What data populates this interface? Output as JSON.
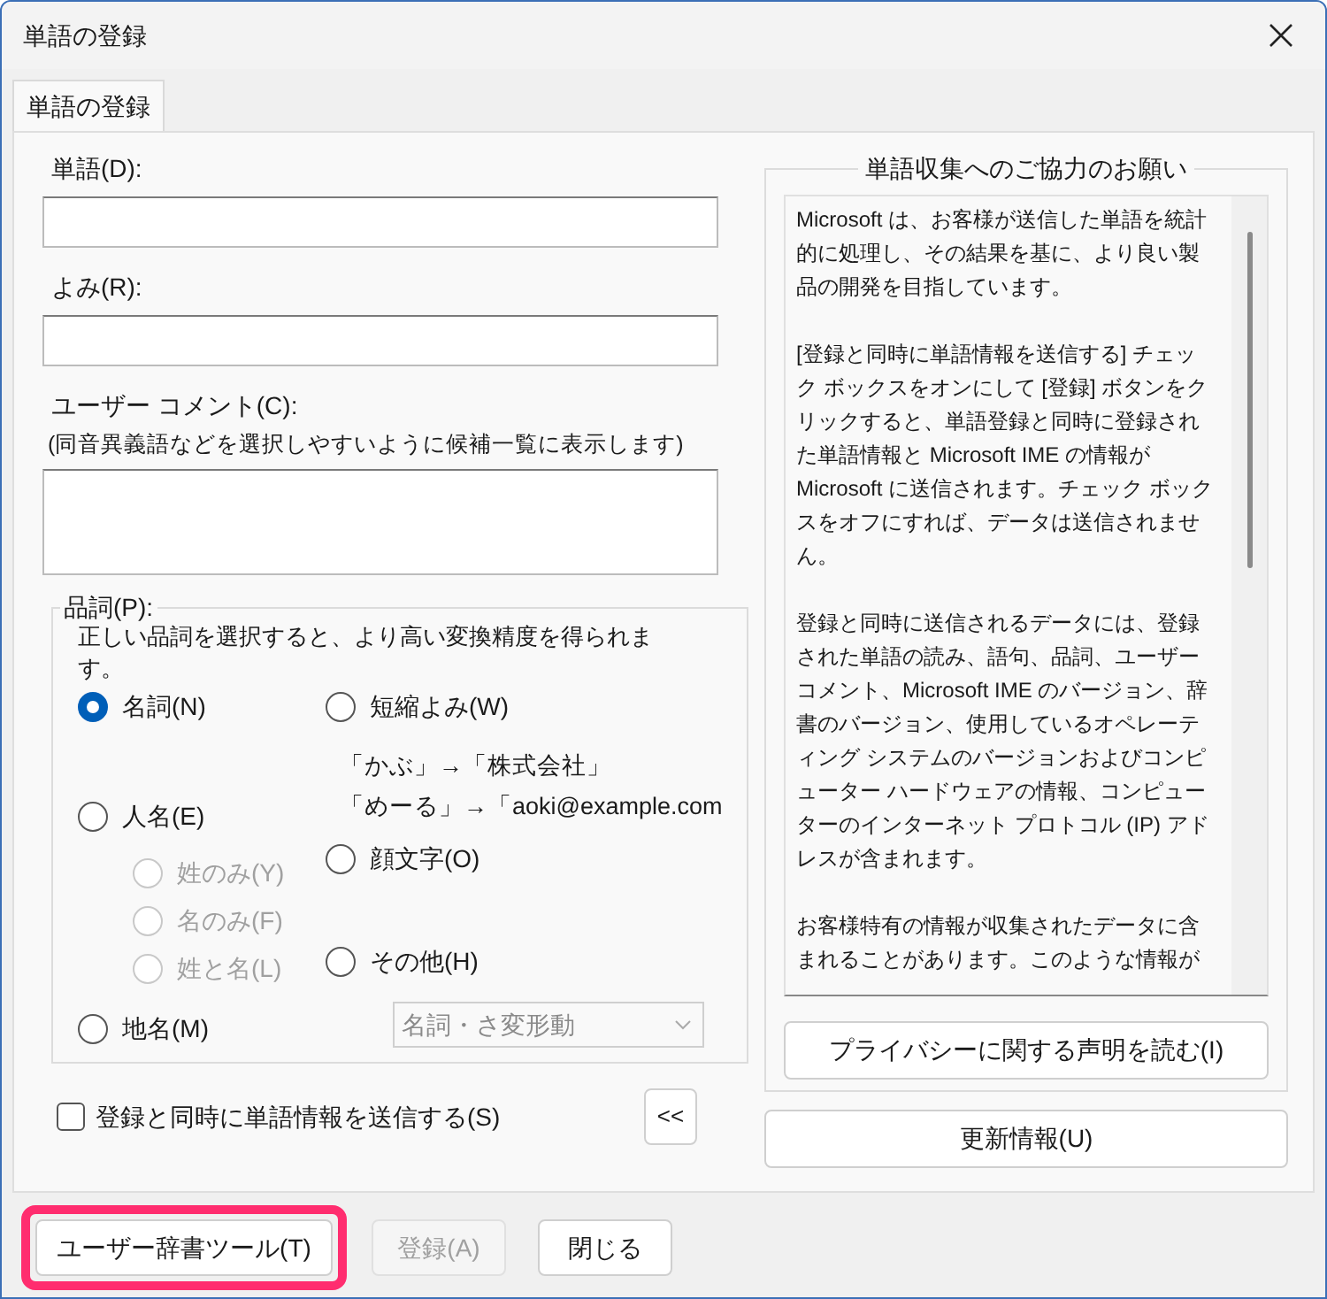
{
  "window": {
    "title": "単語の登録"
  },
  "tabs": [
    {
      "label": "単語の登録",
      "selected": true
    }
  ],
  "fields": [
    {
      "label": "単語(D):",
      "kind": "line"
    },
    {
      "label": "よみ(R):",
      "kind": "line"
    },
    {
      "label": "ユーザー コメント(C):",
      "hint": "(同音異義語などを選択しやすいように候補一覧に表示します)",
      "kind": "area"
    }
  ],
  "part_of_speech": {
    "title": "品詞(P):",
    "description": "正しい品詞を選択すると、より高い変換精度を得られます。",
    "left_options": [
      {
        "label": "名詞(N)",
        "selected": true,
        "disabled": false
      },
      {
        "label": "人名(E)",
        "selected": false,
        "disabled": false,
        "children": [
          {
            "label": "姓のみ(Y)",
            "selected": false,
            "disabled": true
          },
          {
            "label": "名のみ(F)",
            "selected": false,
            "disabled": true
          },
          {
            "label": "姓と名(L)",
            "selected": false,
            "disabled": true
          }
        ]
      },
      {
        "label": "地名(M)",
        "selected": false,
        "disabled": false
      }
    ],
    "right_options": [
      {
        "label": "短縮よみ(W)",
        "selected": false,
        "disabled": false,
        "examples": [
          "「かぶ」→「株式会社」",
          "「めーる」→「aoki@example.com"
        ]
      },
      {
        "label": "顔文字(O)",
        "selected": false,
        "disabled": false
      },
      {
        "label": "その他(H)",
        "selected": false,
        "disabled": false
      }
    ],
    "dropdown": {
      "value": "名詞・さ変形動",
      "disabled": true
    }
  },
  "send_checkbox": {
    "label": "登録と同時に単語情報を送信する(S)",
    "checked": false
  },
  "collapse_button": {
    "label": "<<"
  },
  "info": {
    "title": "単語収集へのご協力のお願い",
    "paragraphs": [
      "Microsoft は、お客様が送信した単語を統計的に処理し、その結果を基に、より良い製品の開発を目指しています。",
      "[登録と同時に単語情報を送信する] チェック ボックスをオンにして [登録] ボタンをクリックすると、単語登録と同時に登録された単語情報と Microsoft IME の情報が Microsoft に送信されます。チェック ボックスをオフにすれば、データは送信されません。",
      "登録と同時に送信されるデータには、登録された単語の読み、語句、品詞、ユーザーコメント、Microsoft IME のバージョン、辞書のバージョン、使用しているオペレーティング システムのバージョンおよびコンピューター ハードウェアの情報、コンピューターのインターネット プロトコル (IP) アドレスが含まれます。",
      "お客様特有の情報が収集されたデータに含まれることがあります。このような情報が"
    ],
    "privacy_button": "プライバシーに関する声明を読む(I)",
    "update_button": "更新情報(U)"
  },
  "buttons": [
    {
      "label": "ユーザー辞書ツール(T)",
      "disabled": false,
      "highlighted": true
    },
    {
      "label": "登録(A)",
      "disabled": true,
      "highlighted": false
    },
    {
      "label": "閉じる",
      "disabled": false,
      "highlighted": false
    }
  ]
}
